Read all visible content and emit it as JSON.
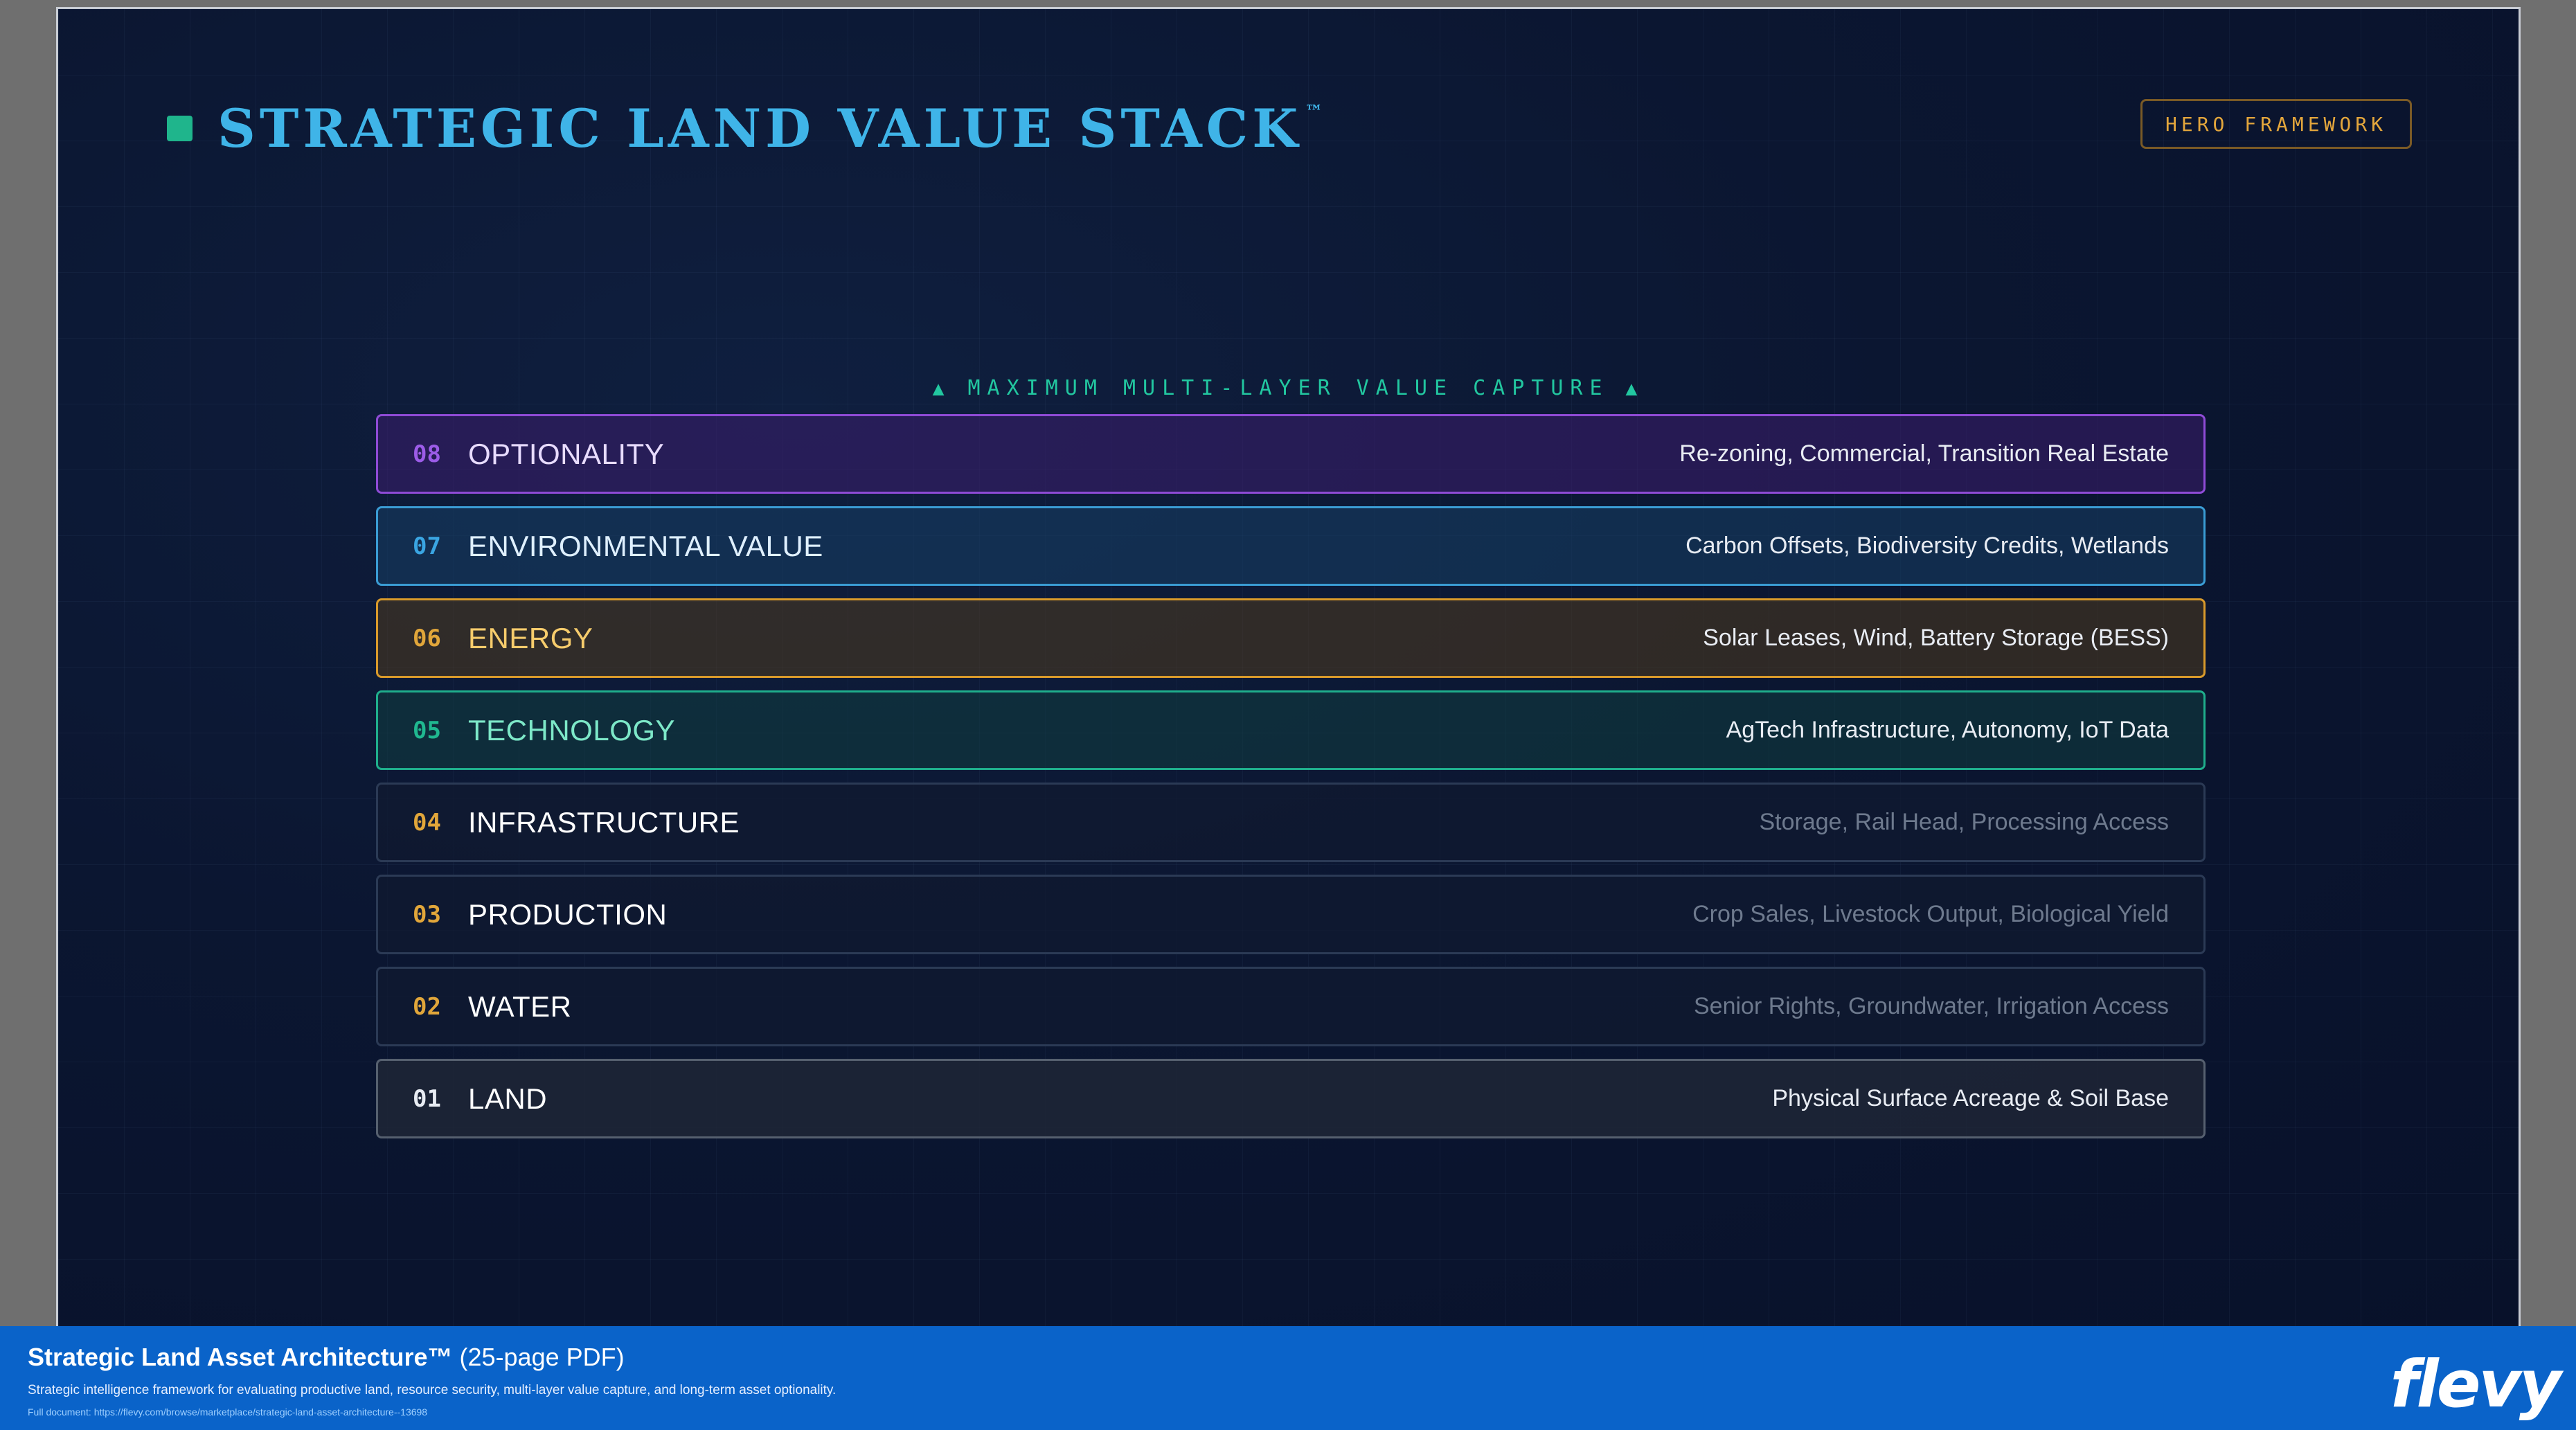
{
  "slide": {
    "title": "STRATEGIC LAND VALUE STACK",
    "title_mark": "™",
    "badge": "HERO FRAMEWORK",
    "capture_label": "MAXIMUM MULTI-LAYER VALUE CAPTURE",
    "capture_icon": "▲"
  },
  "layers": [
    {
      "num": "08",
      "name": "OPTIONALITY",
      "desc": "Re-zoning, Commercial, Transition Real Estate"
    },
    {
      "num": "07",
      "name": "ENVIRONMENTAL VALUE",
      "desc": "Carbon Offsets, Biodiversity Credits, Wetlands"
    },
    {
      "num": "06",
      "name": "ENERGY",
      "desc": "Solar Leases, Wind, Battery Storage (BESS)"
    },
    {
      "num": "05",
      "name": "TECHNOLOGY",
      "desc": "AgTech Infrastructure, Autonomy, IoT Data"
    },
    {
      "num": "04",
      "name": "INFRASTRUCTURE",
      "desc": "Storage, Rail Head, Processing Access"
    },
    {
      "num": "03",
      "name": "PRODUCTION",
      "desc": "Crop Sales, Livestock Output, Biological Yield"
    },
    {
      "num": "02",
      "name": "WATER",
      "desc": "Senior Rights, Groundwater, Irrigation Access"
    },
    {
      "num": "01",
      "name": "LAND",
      "desc": "Physical Surface Acreage & Soil Base"
    }
  ],
  "footer": {
    "title": "Strategic Land Asset Architecture™",
    "title_suffix": "(25-page PDF)",
    "subtitle": "Strategic intelligence framework for evaluating productive land, resource security, multi-layer value capture, and long-term asset optionality.",
    "link": "Full document: https://flevy.com/browse/marketplace/strategic-land-asset-architecture--13698",
    "logo": "flevy"
  },
  "colors": {
    "accent_teal": "#1fb58c",
    "title_blue": "#3fb4e8",
    "badge_gold": "#e3a63c",
    "optionality_purple": "#8f4bd6",
    "environmental_blue": "#3a9cd4",
    "energy_gold": "#d99a2b",
    "technology_teal": "#1fae8c",
    "footer_blue": "#0a63c9"
  }
}
